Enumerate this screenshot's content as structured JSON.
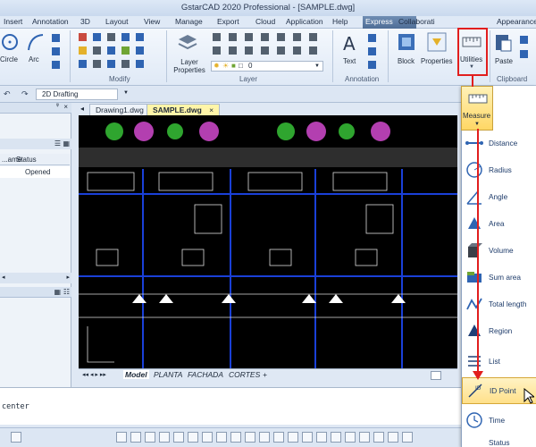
{
  "window": {
    "title": "GstarCAD 2020 Professional - [SAMPLE.dwg]"
  },
  "menu": {
    "items": [
      "Insert",
      "Annotation",
      "3D",
      "Layout",
      "View",
      "Manage",
      "Export",
      "Cloud",
      "Application",
      "Help",
      "Express",
      "Collaborati",
      "Appearance"
    ],
    "active_index": 10
  },
  "ribbon": {
    "draw": {
      "circle_label": "Circle",
      "arc_label": "Arc"
    },
    "modify": {
      "group_label": "Modify"
    },
    "layer": {
      "layer_properties_label": "Layer\nProperties",
      "layer_value": "0",
      "group_label": "Layer"
    },
    "annotation": {
      "text_label": "Text",
      "group_label": "Annotation"
    },
    "block": {
      "label": "Block"
    },
    "properties": {
      "label": "Properties"
    },
    "utilities": {
      "label": "Utilities"
    },
    "clipboard": {
      "paste_label": "Paste",
      "group_label": "Clipboard"
    }
  },
  "workspace": {
    "value": "2D Drafting"
  },
  "left_panel": {
    "columns": [
      "...ame",
      "Status"
    ],
    "rows": [
      {
        "name": "...",
        "status": "Opened"
      }
    ]
  },
  "doc_tabs": [
    {
      "label": "Drawing1.dwg",
      "active": false
    },
    {
      "label": "SAMPLE.dwg",
      "active": true
    }
  ],
  "layout_tabs": [
    "Model",
    "PLANTA",
    "FACHADA",
    "CORTES",
    "+"
  ],
  "command_line": {
    "text": "center"
  },
  "measure": {
    "label": "Measure",
    "items": [
      "Distance",
      "Radius",
      "Angle",
      "Area",
      "Volume",
      "Sum area",
      "Total length",
      "Region",
      "List",
      "ID Point",
      "Time",
      "Status"
    ],
    "hover_index": 9
  },
  "colors": {
    "highlight_red": "#e11e1e",
    "active_tab": "#fff5a8",
    "canvas_bg": "#000000"
  }
}
